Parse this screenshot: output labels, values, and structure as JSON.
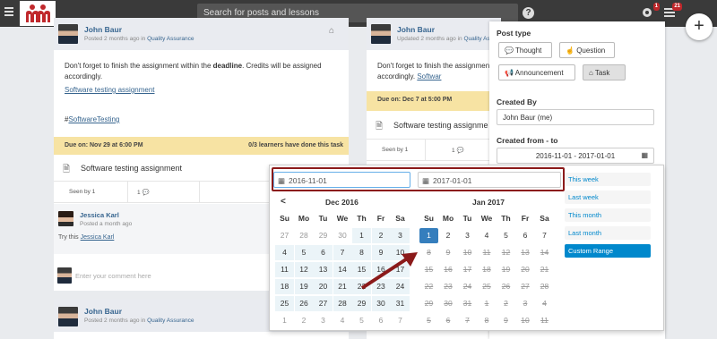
{
  "topbar": {
    "search_placeholder": "Search for posts and lessons",
    "help": "?",
    "notif_count": "1",
    "tasks_count": "21",
    "add": "+"
  },
  "post1": {
    "author": "John Baur",
    "meta_prefix": "Posted 2 months ago in ",
    "meta_group": "Quality Assurance",
    "body_1": "Don't forget to finish the assignment within the ",
    "body_bold": "deadline",
    "body_2": ". Credits will be assigned accordingly.",
    "link": "Software testing assignment",
    "hashtag_prefix": "#",
    "hashtag": "SoftwareTesting",
    "due_label": "Due on: Nov 29 at 6:00 PM",
    "due_status": "0/3 learners have done this task",
    "attachment": "Software testing assignment",
    "seen": "Seen by 1",
    "comments": "1",
    "commenter": "Jessica Karl",
    "comment_meta": "Posted a month ago",
    "comment_text": "Try this ",
    "comment_link": "Jessica Karl",
    "comment_placeholder": "Enter your comment here"
  },
  "post2": {
    "author": "John Baur",
    "meta_prefix": "Updated 2 months ago in ",
    "meta_group": "Quality Assurance",
    "body_1": "Don't forget to finish the assignment within the",
    "body_2": "accordingly. ",
    "link": "Softwar",
    "due_label": "Due on: Dec 7 at 5:00 PM",
    "attachment": "Software testing assignme",
    "seen": "Seen by 1",
    "comments": "1"
  },
  "post3": {
    "author": "John Baur",
    "meta_prefix": "Posted 2 months ago in ",
    "meta_group": "Quality Assurance"
  },
  "filter": {
    "post_type_label": "Post type",
    "thought": "Thought",
    "question": "Question",
    "announcement": "Announcement",
    "task": "Task",
    "created_by_label": "Created By",
    "created_by_value": "John Baur (me)",
    "created_range_label": "Created from - to",
    "created_range_value": "2016-11-01 - 2017-01-01"
  },
  "daterange": {
    "start": "2016-11-01",
    "end": "2017-01-01",
    "left_title": "Dec 2016",
    "right_title": "Jan 2017",
    "prev": "<",
    "dow": [
      "Su",
      "Mo",
      "Tu",
      "We",
      "Th",
      "Fr",
      "Sa"
    ],
    "left_days": [
      [
        "27",
        "28",
        "29",
        "30",
        "1",
        "2",
        "3"
      ],
      [
        "4",
        "5",
        "6",
        "7",
        "8",
        "9",
        "10"
      ],
      [
        "11",
        "12",
        "13",
        "14",
        "15",
        "16",
        "17"
      ],
      [
        "18",
        "19",
        "20",
        "21",
        "22",
        "23",
        "24"
      ],
      [
        "25",
        "26",
        "27",
        "28",
        "29",
        "30",
        "31"
      ],
      [
        "1",
        "2",
        "3",
        "4",
        "5",
        "6",
        "7"
      ]
    ],
    "right_days": [
      [
        "1",
        "2",
        "3",
        "4",
        "5",
        "6",
        "7"
      ],
      [
        "8",
        "9",
        "10",
        "11",
        "12",
        "13",
        "14"
      ],
      [
        "15",
        "16",
        "17",
        "18",
        "19",
        "20",
        "21"
      ],
      [
        "22",
        "23",
        "24",
        "25",
        "26",
        "27",
        "28"
      ],
      [
        "29",
        "30",
        "31",
        "1",
        "2",
        "3",
        "4"
      ],
      [
        "5",
        "6",
        "7",
        "8",
        "9",
        "10",
        "11"
      ]
    ],
    "ranges": [
      "This week",
      "Last week",
      "This month",
      "Last month",
      "Custom Range"
    ],
    "arrow_color": "#8b1a1a",
    "highlight_color": "#357ebd"
  }
}
